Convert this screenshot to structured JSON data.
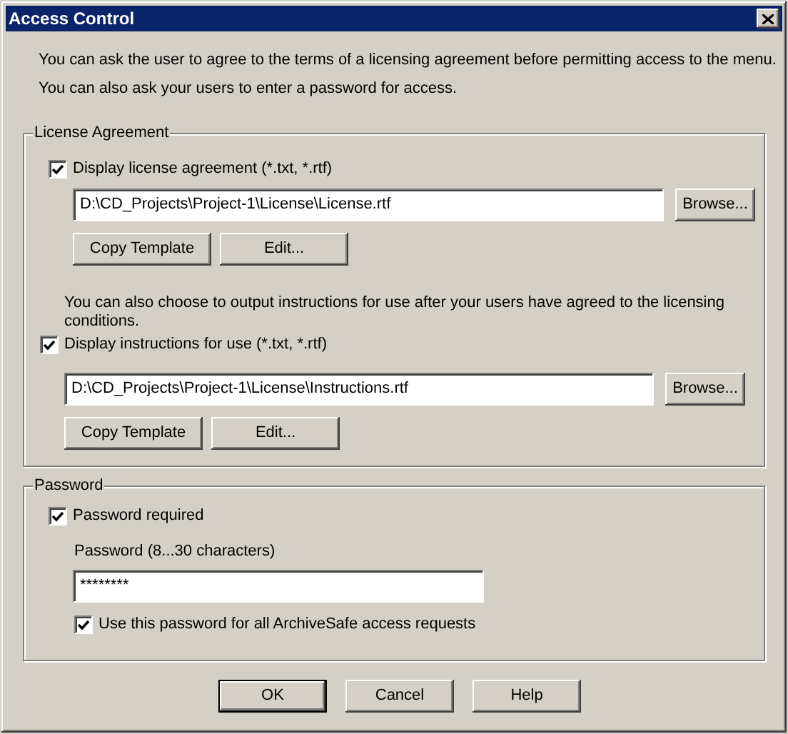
{
  "window": {
    "title": "Access Control"
  },
  "intro": [
    "You can ask the user to agree to the terms of a licensing agreement before permitting access to the menu.",
    "You can also ask your users to enter a password for access."
  ],
  "license_agreement": {
    "legend": "License Agreement",
    "license": {
      "checkbox": {
        "label": "Display license agreement (*.txt, *.rtf)",
        "checked": true
      },
      "path": "D:\\CD_Projects\\Project-1\\License\\License.rtf",
      "browse": "Browse...",
      "copy_template": "Copy Template",
      "edit": "Edit..."
    },
    "note": "You can also choose to output instructions for use after your users have agreed to the licensing conditions.",
    "instructions": {
      "checkbox": {
        "label": "Display instructions for use (*.txt, *.rtf)",
        "checked": true
      },
      "path": "D:\\CD_Projects\\Project-1\\License\\Instructions.rtf",
      "browse": "Browse...",
      "copy_template": "Copy Template",
      "edit": "Edit..."
    }
  },
  "password": {
    "legend": "Password",
    "required": {
      "label": "Password required",
      "checked": true
    },
    "field_label": "Password (8...30 characters)",
    "value": "********",
    "use_for_all": {
      "label": "Use this password for all ArchiveSafe access requests",
      "checked": true
    }
  },
  "buttons": [
    {
      "label": "OK",
      "default": true
    },
    {
      "label": "Cancel",
      "default": false
    },
    {
      "label": "Help",
      "default": false
    }
  ]
}
